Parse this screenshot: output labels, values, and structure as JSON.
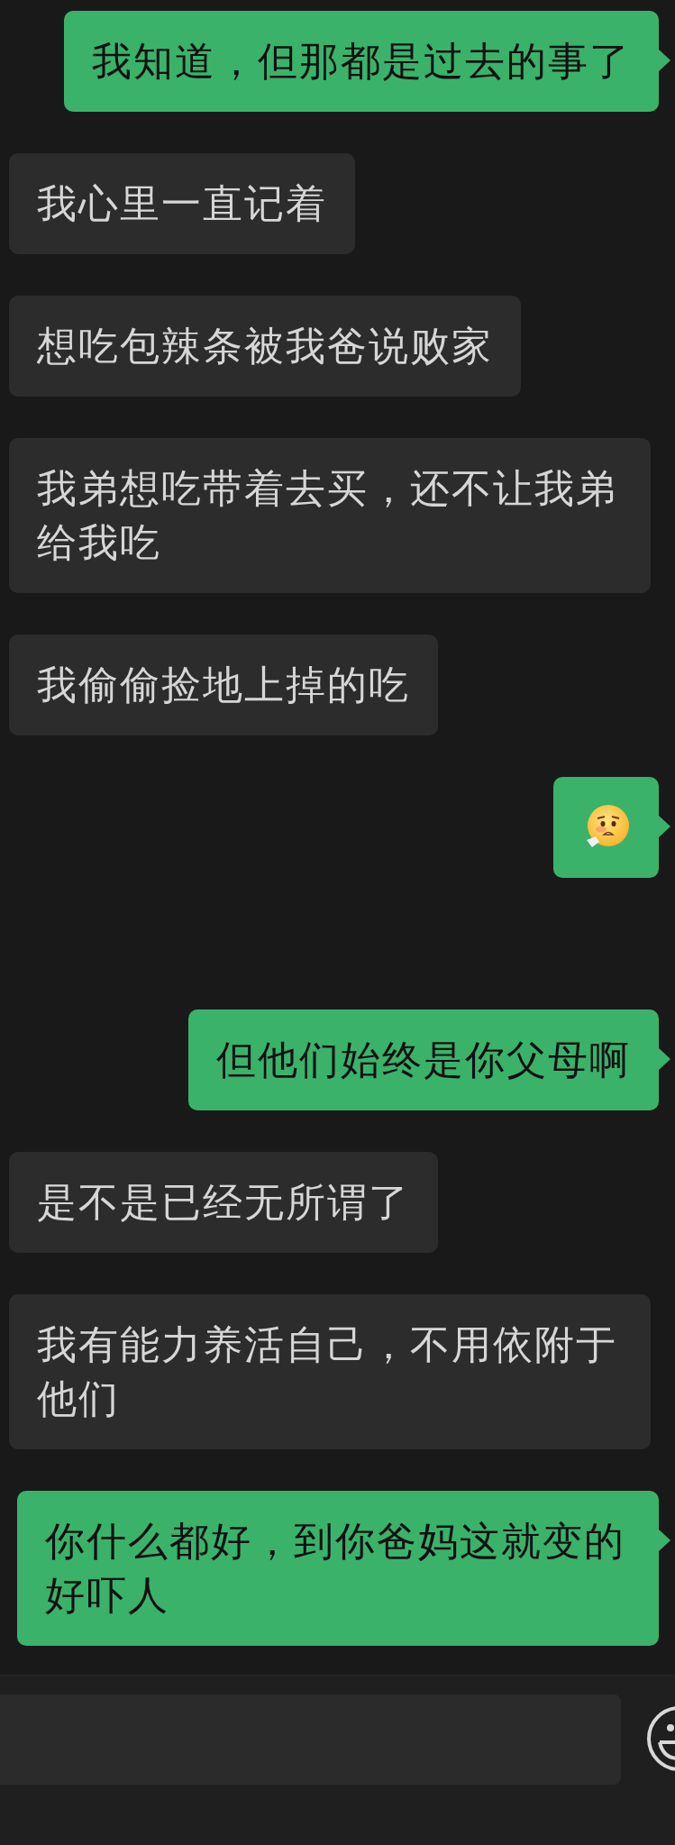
{
  "messages": [
    {
      "outgoing": true,
      "kind": "text",
      "text": "我知道，但那都是过去的事了"
    },
    {
      "outgoing": false,
      "kind": "text",
      "text": "我心里一直记着"
    },
    {
      "outgoing": false,
      "kind": "text",
      "text": "想吃包辣条被我爸说败家"
    },
    {
      "outgoing": false,
      "kind": "text",
      "text": "我弟想吃带着去买，还不让我弟给我吃"
    },
    {
      "outgoing": false,
      "kind": "text",
      "text": "我偷偷捡地上掉的吃"
    },
    {
      "outgoing": true,
      "kind": "emoji"
    },
    {
      "outgoing": true,
      "kind": "text",
      "text": "但他们始终是你父母啊"
    },
    {
      "outgoing": false,
      "kind": "text",
      "text": "是不是已经无所谓了"
    },
    {
      "outgoing": false,
      "kind": "text",
      "text": "我有能力养活自己，不用依附于他们"
    },
    {
      "outgoing": true,
      "kind": "text",
      "text": "你什么都好，到你爸妈这就变的好吓人"
    }
  ]
}
